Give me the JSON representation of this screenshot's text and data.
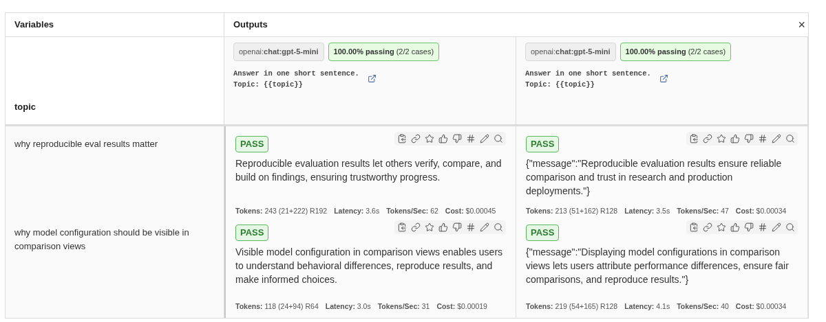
{
  "header": {
    "variables": "Variables",
    "outputs": "Outputs",
    "close": "×"
  },
  "variable_name": "topic",
  "prompts": [
    {
      "provider": "openai:**chat:gpt-5-mini**",
      "passing": "**100.00% passing** (2/2 cases)",
      "text": "Answer in one short sentence.\nTopic: {{topic}}"
    },
    {
      "provider": "openai:**chat:gpt-5-mini**",
      "passing": "**100.00% passing** (2/2 cases)",
      "text": "Answer in one short sentence.\nTopic: {{topic}}"
    }
  ],
  "rows": [
    {
      "topic": "why reproducible eval results matter",
      "outputs": [
        {
          "status": "PASS",
          "kind": "pass",
          "text": "Reproducible evaluation results let others verify, compare, and build on findings, ensuring trustworthy progress.",
          "stats": [
            "**Tokens:** 243 (21+222) R192",
            "**Latency:** 3.6s",
            "**Tokens/Sec:** 62",
            "**Cost:** $0.00045"
          ]
        },
        {
          "status": "PASS",
          "kind": "pass",
          "text": "{\"message\":\"Reproducible evaluation results ensure reliable comparison and trust in research and production deployments.\"}",
          "stats": [
            "**Tokens:** 213 (51+162) R128",
            "**Latency:** 3.5s",
            "**Tokens/Sec:** 47",
            "**Cost:** $0.00034"
          ]
        }
      ]
    },
    {
      "topic": "why model configuration should be visible in comparison views",
      "outputs": [
        {
          "status": "PASS",
          "kind": "pass",
          "text": "Visible model configuration in comparison views enables users to understand behavioral differences, reproduce results, and make informed choices.",
          "stats": [
            "**Tokens:** 118 (24+94) R64",
            "**Latency:** 3.0s",
            "**Tokens/Sec:** 31",
            "**Cost:** $0.00019"
          ]
        },
        {
          "status": "PASS",
          "kind": "pass",
          "text": "{\"message\":\"Displaying model configurations in comparison views lets users attribute performance differences, ensure fair comparisons, and reproduce results.\"}",
          "stats": [
            "**Tokens:** 219 (54+165) R128",
            "**Latency:** 4.1s",
            "**Tokens/Sec:** 40",
            "**Cost:** $0.00034"
          ]
        }
      ]
    }
  ]
}
